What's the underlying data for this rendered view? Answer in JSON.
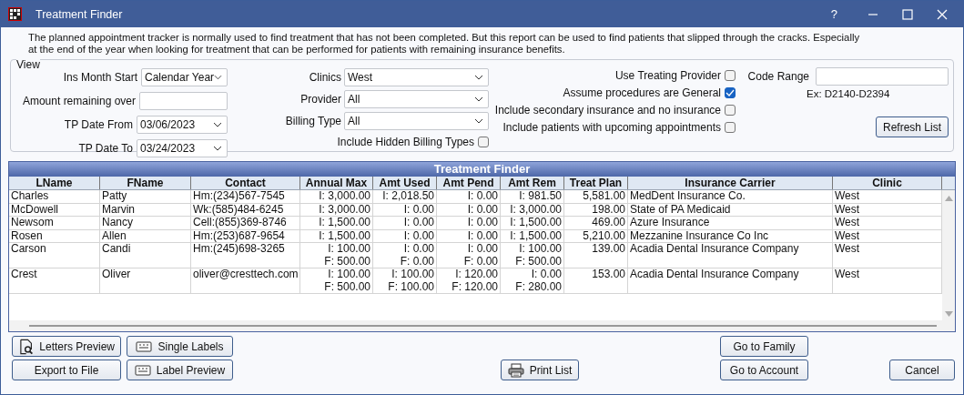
{
  "window": {
    "title": "Treatment Finder",
    "help": "?"
  },
  "description": [
    "The planned appointment tracker is normally used to find treatment that has not been completed.  But this report can be used to find patients that slipped through the cracks.  Especially",
    "at the end of the year when looking for treatment that can be performed for patients with remaining insurance benefits."
  ],
  "view": {
    "title": "View",
    "left_fields": [
      {
        "label": "Ins Month Start",
        "kind": "dropdown",
        "value": "Calendar Year"
      },
      {
        "label": "Amount remaining over",
        "kind": "text"
      },
      {
        "label": "TP Date From",
        "kind": "date",
        "value": "03/06/2023"
      },
      {
        "label": "TP Date To",
        "kind": "date",
        "value": "03/24/2023"
      }
    ],
    "middle_fields": [
      {
        "label": "Clinics",
        "value": "West"
      },
      {
        "label": "Provider",
        "value": "All"
      },
      {
        "label": "Billing Type",
        "value": "All"
      }
    ],
    "hidden_billing": {
      "label": "Include Hidden Billing Types",
      "checked": false
    },
    "options": [
      {
        "label": "Use Treating Provider",
        "checked": false
      },
      {
        "label": "Assume procedures are General",
        "checked": true
      },
      {
        "label": "Include secondary insurance and no insurance",
        "checked": false
      },
      {
        "label": "Include patients with upcoming appointments",
        "checked": false
      }
    ],
    "code_range": {
      "label": "Code Range",
      "hint": "Ex: D2140-D2394"
    },
    "refresh_button": "Refresh List"
  },
  "grid": {
    "title": "Treatment Finder",
    "columns": [
      {
        "label": "LName",
        "kind": "text"
      },
      {
        "label": "FName",
        "kind": "text"
      },
      {
        "label": "Contact",
        "kind": "text"
      },
      {
        "label": "Annual Max",
        "kind": "amount"
      },
      {
        "label": "Amt Used",
        "kind": "amount"
      },
      {
        "label": "Amt Pend",
        "kind": "amount"
      },
      {
        "label": "Amt Rem",
        "kind": "amount"
      },
      {
        "label": "Treat Plan",
        "kind": "amount"
      },
      {
        "label": "Insurance Carrier",
        "kind": "text"
      },
      {
        "label": "Clinic",
        "kind": "text"
      }
    ],
    "rows": [
      {
        "cells": [
          "Charles",
          "Patty",
          "Hm:(234)567-7545",
          "I: 3,000.00",
          "I: 2,018.50",
          "I: 0.00",
          "I: 981.50",
          "5,581.00",
          "MedDent Insurance Co.",
          "West"
        ]
      },
      {
        "cells": [
          "McDowell",
          "Marvin",
          "Wk:(585)484-6245",
          "I: 3,000.00",
          "I: 0.00",
          "I: 0.00",
          "I: 3,000.00",
          "198.00",
          "State of PA Medicaid",
          "West"
        ]
      },
      {
        "cells": [
          "Newsom",
          "Nancy",
          "Cell:(855)369-8746",
          "I: 1,500.00",
          "I: 0.00",
          "I: 0.00",
          "I: 1,500.00",
          "469.00",
          "Azure Insurance",
          "West"
        ]
      },
      {
        "cells": [
          "Rosen",
          "Allen",
          "Hm:(253)687-9654",
          "I: 1,500.00",
          "I: 0.00",
          "I: 0.00",
          "I: 1,500.00",
          "5,210.00",
          "Mezzanine Insurance Co Inc",
          "West"
        ]
      },
      {
        "cells": [
          "Carson",
          "Candi",
          "Hm:(245)698-3265",
          "I: 100.00\nF: 500.00",
          "I: 0.00\nF: 0.00",
          "I: 0.00\nF: 0.00",
          "I: 100.00\nF: 500.00",
          "139.00",
          "Acadia Dental Insurance Company",
          "West"
        ]
      },
      {
        "cells": [
          "Crest",
          "Oliver",
          "oliver@cresttech.com",
          "I: 100.00\nF: 500.00",
          "I: 100.00\nF: 100.00",
          "I: 120.00\nF: 120.00",
          "I: 0.00\nF: 280.00",
          "153.00",
          "Acadia Dental Insurance Company",
          "West"
        ]
      }
    ]
  },
  "buttons": {
    "left": [
      {
        "label": "Letters Preview",
        "kind": "preview"
      },
      {
        "label": "Single Labels",
        "kind": "label"
      },
      {
        "label": "Export to File",
        "kind": "plain"
      },
      {
        "label": "Label Preview",
        "kind": "label"
      }
    ],
    "center": [
      {
        "label": "Print List",
        "kind": "print"
      }
    ],
    "right": [
      {
        "label": "Go to Family"
      },
      {
        "label": "Go to Account"
      }
    ],
    "cancel": "Cancel"
  }
}
